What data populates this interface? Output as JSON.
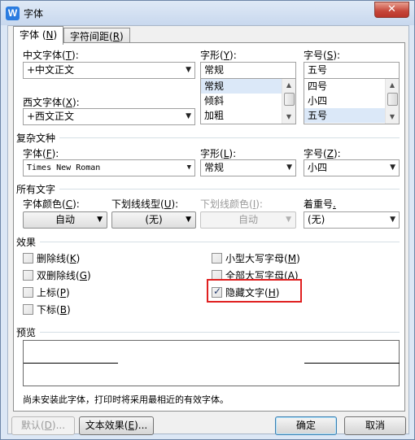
{
  "window": {
    "title": "字体",
    "icon": "wps-writer-logo-icon",
    "close_label": "✕"
  },
  "tabs": [
    {
      "label": "字体",
      "hotkey": "N"
    },
    {
      "label": "字符间距",
      "hotkey": "R"
    }
  ],
  "font": {
    "chinese_font": {
      "label": "中文字体",
      "hotkey": "T",
      "value": "+中文正文"
    },
    "style": {
      "label": "字形",
      "hotkey": "Y",
      "value": "常规",
      "options": [
        "常规",
        "倾斜",
        "加粗"
      ],
      "selected_index": 0
    },
    "size": {
      "label": "字号",
      "hotkey": "S",
      "value": "五号",
      "options": [
        "四号",
        "小四",
        "五号"
      ],
      "selected_index": 2
    },
    "western_font": {
      "label": "西文字体",
      "hotkey": "X",
      "value": "+西文正文"
    }
  },
  "complex": {
    "section_title": "复杂文种",
    "font": {
      "label": "字体",
      "hotkey": "F",
      "value": "Times New Roman"
    },
    "style": {
      "label": "字形",
      "hotkey": "L",
      "value": "常规"
    },
    "size": {
      "label": "字号",
      "hotkey": "Z",
      "value": "小四"
    }
  },
  "all_text": {
    "section_title": "所有文字",
    "font_color": {
      "label": "字体颜色",
      "hotkey": "C",
      "value": "自动"
    },
    "underline_style": {
      "label": "下划线线型",
      "hotkey": "U",
      "value": "(无)"
    },
    "underline_color": {
      "label": "下划线颜色",
      "hotkey": "I",
      "value": "自动",
      "disabled": true
    },
    "emphasis": {
      "label": "着重号",
      "hotkey": ".",
      "value": "(无)"
    }
  },
  "effects": {
    "section_title": "效果",
    "left": [
      {
        "label": "删除线",
        "hotkey": "K",
        "checked": false
      },
      {
        "label": "双删除线",
        "hotkey": "G",
        "checked": false
      },
      {
        "label": "上标",
        "hotkey": "P",
        "checked": false
      },
      {
        "label": "下标",
        "hotkey": "B",
        "checked": false
      }
    ],
    "right": [
      {
        "label": "小型大写字母",
        "hotkey": "M",
        "checked": false
      },
      {
        "label": "全部大写字母",
        "hotkey": "A",
        "checked": false
      },
      {
        "label": "隐藏文字",
        "hotkey": "H",
        "checked": true
      }
    ]
  },
  "preview": {
    "section_title": "预览",
    "note": "尚未安装此字体，打印时将采用最相近的有效字体。"
  },
  "buttons": {
    "default": {
      "label": "默认",
      "hotkey": "D",
      "suffix": "...",
      "disabled": true
    },
    "text_effects": {
      "label": "文本效果",
      "hotkey": "E",
      "suffix": "..."
    },
    "ok": {
      "label": "确定"
    },
    "cancel": {
      "label": "取消"
    }
  },
  "colors": {
    "highlight_border": "#e02020",
    "accent": "#3c7fb1"
  }
}
